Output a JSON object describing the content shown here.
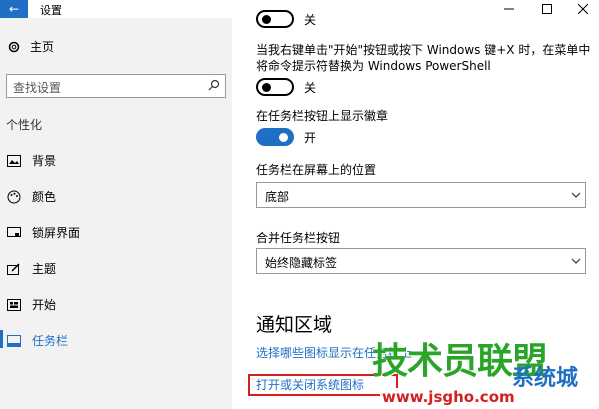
{
  "window": {
    "title": "设置",
    "back_icon": "arrow-left-icon",
    "controls": [
      "minimize-icon",
      "maximize-icon",
      "close-icon"
    ]
  },
  "sidebar": {
    "home_label": "主页",
    "search_placeholder": "查找设置",
    "section_label": "个性化",
    "items": [
      {
        "label": "背景",
        "icon": "picture-icon"
      },
      {
        "label": "颜色",
        "icon": "palette-icon"
      },
      {
        "label": "锁屏界面",
        "icon": "lockscreen-icon"
      },
      {
        "label": "主题",
        "icon": "theme-icon"
      },
      {
        "label": "开始",
        "icon": "start-icon"
      },
      {
        "label": "任务栏",
        "icon": "taskbar-icon",
        "active": true
      }
    ]
  },
  "main": {
    "top_toggle_state": "关",
    "powershell_desc": "当我右键单击\"开始\"按钮或按下 Windows 键+X 时，在菜单中将命令提示符替换为 Windows PowerShell",
    "powershell_toggle_state": "关",
    "badge_label": "在任务栏按钮上显示徽章",
    "badge_toggle_state": "开",
    "position_label": "任务栏在屏幕上的位置",
    "position_value": "底部",
    "combine_label": "合并任务栏按钮",
    "combine_value": "始终隐藏标签",
    "notification_heading": "通知区域",
    "link_icons": "选择哪些图标显示在任务栏上",
    "link_system_icons": "打开或关闭系统图标"
  },
  "watermark": {
    "main_text": "技术员联盟",
    "sub_text": "系统城",
    "url": "www.jsgho.com"
  },
  "colors": {
    "accent": "#1f6fc5",
    "sidebar_bg": "#f2f2f2",
    "highlight_box": "#d42020",
    "watermark_green": "#2aa52a"
  }
}
